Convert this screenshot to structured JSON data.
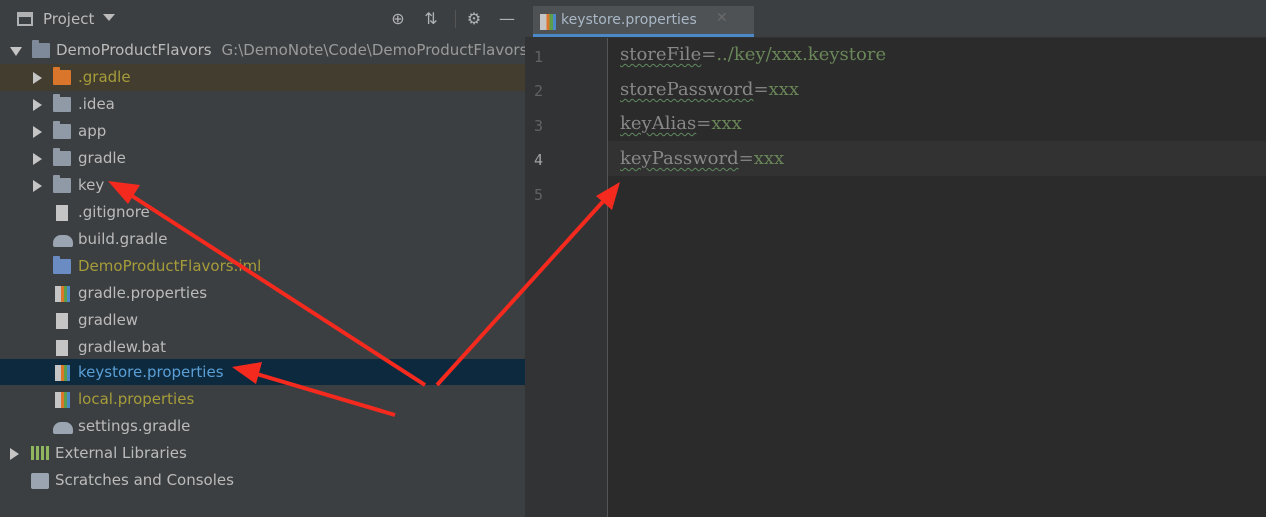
{
  "panel": {
    "title": "Project"
  },
  "tree": {
    "root": {
      "name": "DemoProductFlavors",
      "path": "G:\\DemoNote\\Code\\DemoProductFlavors"
    },
    "items": [
      {
        "label": ".gradle",
        "color": "#a69c3a"
      },
      {
        "label": ".idea",
        "color": "#bbbbbb"
      },
      {
        "label": "app",
        "color": "#bbbbbb"
      },
      {
        "label": "gradle",
        "color": "#bbbbbb"
      },
      {
        "label": "key",
        "color": "#bbbbbb"
      },
      {
        "label": ".gitignore",
        "color": "#bbbbbb"
      },
      {
        "label": "build.gradle",
        "color": "#bbbbbb"
      },
      {
        "label": "DemoProductFlavors.iml",
        "color": "#a69c3a"
      },
      {
        "label": "gradle.properties",
        "color": "#bbbbbb"
      },
      {
        "label": "gradlew",
        "color": "#bbbbbb"
      },
      {
        "label": "gradlew.bat",
        "color": "#bbbbbb"
      },
      {
        "label": "keystore.properties",
        "color": "#5a9fd6"
      },
      {
        "label": "local.properties",
        "color": "#a69c3a"
      },
      {
        "label": "settings.gradle",
        "color": "#bbbbbb"
      }
    ],
    "external": "External Libraries",
    "scratches": "Scratches and Consoles"
  },
  "editor": {
    "tab": "keystore.properties",
    "line_numbers": [
      "1",
      "2",
      "3",
      "4",
      "5"
    ],
    "lines": [
      {
        "key": "storeFile",
        "eq": "=",
        "value": "../key/xxx.keystore"
      },
      {
        "key": "storePassword",
        "eq": "=",
        "value": "xxx"
      },
      {
        "key": "keyAlias",
        "eq": "=",
        "value": "xxx"
      },
      {
        "key": "keyPassword",
        "eq": "=",
        "value": "xxx"
      }
    ]
  },
  "colors": {
    "annotation_arrow": "#f52a1f",
    "selection": "#0d293e",
    "accent": "#4a88c7"
  }
}
